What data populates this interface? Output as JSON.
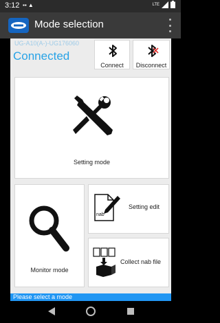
{
  "status_bar": {
    "time": "3:12",
    "left_icons": "▪▪ ▲",
    "network": "LTE"
  },
  "app_bar": {
    "title": "Mode selection"
  },
  "device": {
    "id": "UG-A10(A-)-UG176060",
    "connection_status": "Connected"
  },
  "actions": {
    "connect_label": "Connect",
    "disconnect_label": "Disconnect"
  },
  "modes": {
    "setting_label": "Setting mode",
    "monitor_label": "Monitor mode",
    "setting_edit_label": "Setting edit",
    "collect_label": "Collect nab file",
    "nab_icon_text": "nab"
  },
  "status_message": "Please select a mode",
  "colors": {
    "accent_blue": "#29a3e6",
    "status_strip": "#2196f3",
    "disconnect_x": "#e53935"
  }
}
